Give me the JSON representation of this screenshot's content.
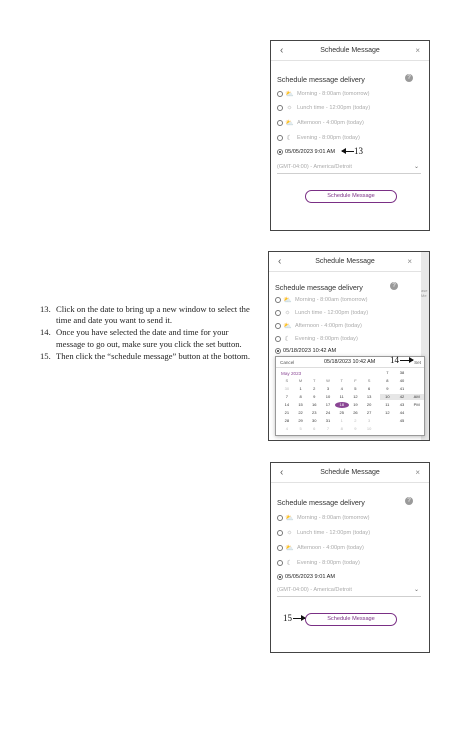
{
  "instructions": [
    {
      "num": "13.",
      "text": "Click on the date to bring up a new window to select the time and date you want to send it."
    },
    {
      "num": "14.",
      "text": "Once you have selected the date and time for your message to go out, make sure you click the set button."
    },
    {
      "num": "15.",
      "text": "Then click the “schedule message” button at the bottom."
    }
  ],
  "panel1": {
    "back": "‹",
    "title": "Schedule Message",
    "close": "×",
    "subtitle": "Schedule message delivery",
    "help": "?",
    "options": [
      {
        "label": "Morning - 8:00am (tomorrow)",
        "icon": "sunrise-icon",
        "glyph": "⛅"
      },
      {
        "label": "Lunch time - 12:00pm (today)",
        "icon": "sun-icon",
        "glyph": "☼"
      },
      {
        "label": "Afternoon - 4:00pm (today)",
        "icon": "sunset-icon",
        "glyph": "⛅"
      },
      {
        "label": "Evening - 8:00pm (today)",
        "icon": "moon-icon",
        "glyph": "☾"
      }
    ],
    "selected": "05/05/2023 9:01 AM",
    "timezone": "(GMT-04:00) - America/Detroit",
    "button": "Schedule Message",
    "callout": "13"
  },
  "panel2": {
    "back": "‹",
    "title": "Schedule Message",
    "close": "×",
    "subtitle": "Schedule message delivery",
    "help": "?",
    "options": [
      {
        "label": "Morning - 8:00am (tomorrow)",
        "icon": "sunrise-icon",
        "glyph": "⛅"
      },
      {
        "label": "Lunch time - 12:00pm (today)",
        "icon": "sun-icon",
        "glyph": "☼"
      },
      {
        "label": "Afternoon - 4:00pm (today)",
        "icon": "sunset-icon",
        "glyph": "⛅"
      },
      {
        "label": "Evening - 8:00pm (today)",
        "icon": "moon-icon",
        "glyph": "☾"
      }
    ],
    "selected": "05/18/2023 10:42 AM",
    "edge_text": "ase Me",
    "picker": {
      "cancel": "Cancel",
      "datetime": "05/18/2023 10:42 AM",
      "set": "Set",
      "month": "May 2023",
      "weekdays": [
        "S",
        "M",
        "T",
        "W",
        "T",
        "F",
        "S"
      ],
      "days": [
        "30",
        "1",
        "2",
        "3",
        "4",
        "5",
        "6",
        "7",
        "8",
        "9",
        "10",
        "11",
        "12",
        "13",
        "14",
        "15",
        "16",
        "17",
        "18",
        "19",
        "20",
        "21",
        "22",
        "23",
        "24",
        "25",
        "26",
        "27",
        "28",
        "29",
        "30",
        "31",
        "1",
        "2",
        "3",
        "4",
        "5",
        "6",
        "7",
        "8",
        "9",
        "10"
      ],
      "selected_day": "18",
      "times": [
        [
          "7",
          "38",
          ""
        ],
        [
          "8",
          "40",
          ""
        ],
        [
          "9",
          "41",
          ""
        ],
        [
          "10",
          "42",
          "AM"
        ],
        [
          "11",
          "43",
          "PM"
        ],
        [
          "12",
          "44",
          ""
        ],
        [
          "",
          "45",
          ""
        ]
      ]
    },
    "callout": "14"
  },
  "panel3": {
    "back": "‹",
    "title": "Schedule Message",
    "close": "×",
    "subtitle": "Schedule message delivery",
    "help": "?",
    "options": [
      {
        "label": "Morning - 8:00am (tomorrow)",
        "icon": "sunrise-icon",
        "glyph": "⛅"
      },
      {
        "label": "Lunch time - 12:00pm (today)",
        "icon": "sun-icon",
        "glyph": "☼"
      },
      {
        "label": "Afternoon - 4:00pm (today)",
        "icon": "sunset-icon",
        "glyph": "⛅"
      },
      {
        "label": "Evening - 8:00pm (today)",
        "icon": "moon-icon",
        "glyph": "☾"
      }
    ],
    "selected": "05/05/2023 9:01 AM",
    "timezone": "(GMT-04:00) - America/Detroit",
    "button": "Schedule Message",
    "callout": "15"
  }
}
